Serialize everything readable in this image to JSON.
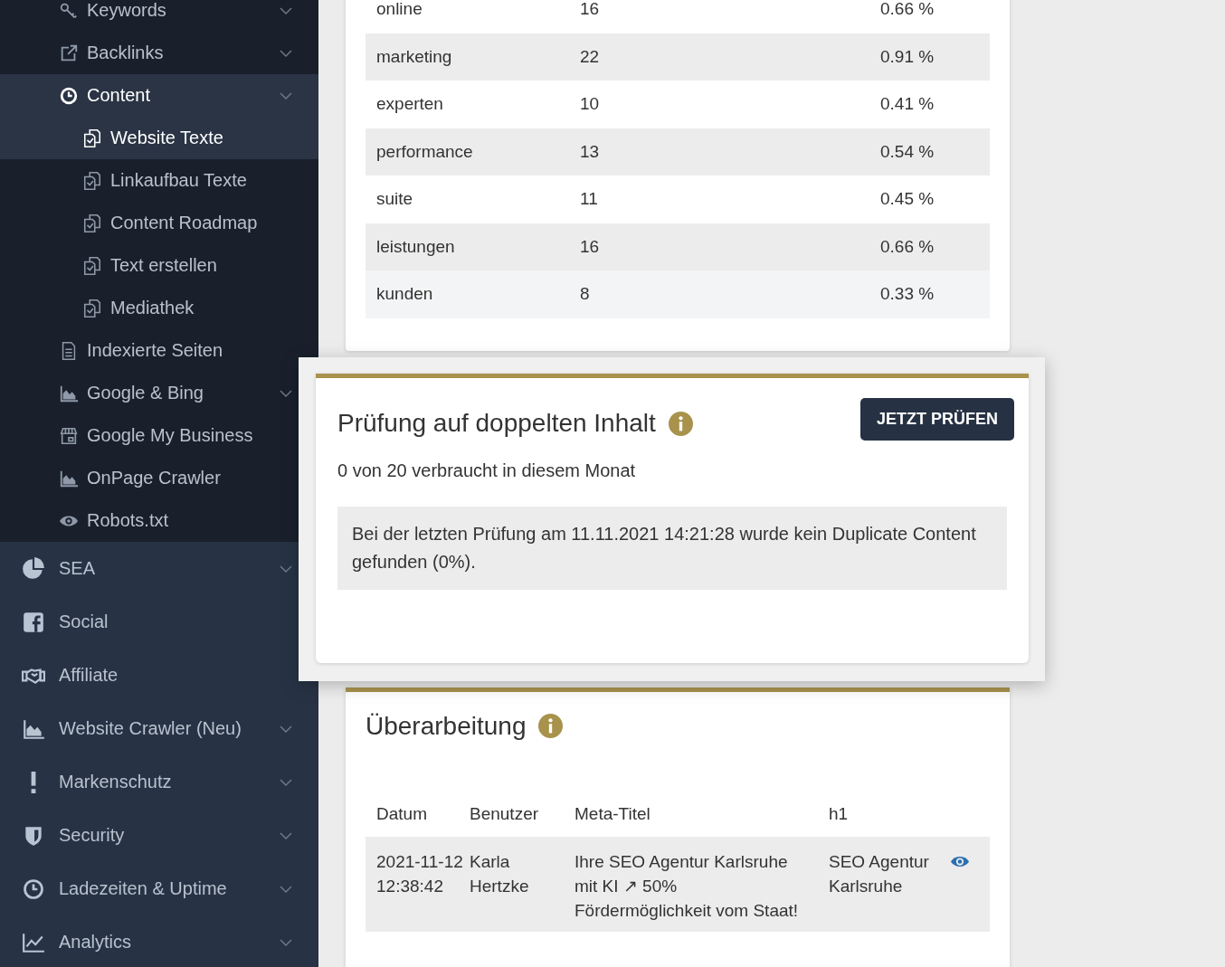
{
  "sidebar": {
    "sub_items": [
      {
        "label": "Keywords",
        "has_submenu": true,
        "expanded": false,
        "selected": false
      },
      {
        "label": "Backlinks",
        "has_submenu": true,
        "expanded": false,
        "selected": false
      },
      {
        "label": "Content",
        "has_submenu": true,
        "expanded": true,
        "selected": true,
        "children": [
          {
            "label": "Website Texte",
            "selected": true
          },
          {
            "label": "Linkaufbau Texte",
            "selected": false
          },
          {
            "label": "Content Roadmap",
            "selected": false
          },
          {
            "label": "Text erstellen",
            "selected": false
          },
          {
            "label": "Mediathek",
            "selected": false
          }
        ]
      },
      {
        "label": "Indexierte Seiten",
        "has_submenu": false,
        "selected": false
      },
      {
        "label": "Google & Bing",
        "has_submenu": true,
        "expanded": false,
        "selected": false
      },
      {
        "label": "Google My Business",
        "has_submenu": false,
        "selected": false
      },
      {
        "label": "OnPage Crawler",
        "has_submenu": false,
        "selected": false
      },
      {
        "label": "Robots.txt",
        "has_submenu": false,
        "selected": false
      }
    ],
    "items": [
      {
        "label": "SEA",
        "has_submenu": true
      },
      {
        "label": "Social",
        "has_submenu": false
      },
      {
        "label": "Affiliate",
        "has_submenu": false
      },
      {
        "label": "Website Crawler (Neu)",
        "has_submenu": true
      },
      {
        "label": "Markenschutz",
        "has_submenu": true
      },
      {
        "label": "Security",
        "has_submenu": true
      },
      {
        "label": "Ladezeiten & Uptime",
        "has_submenu": true
      },
      {
        "label": "Analytics",
        "has_submenu": true
      }
    ]
  },
  "keyword_table": {
    "rows": [
      {
        "word": "online",
        "count": "16",
        "density": "0.66 %"
      },
      {
        "word": "marketing",
        "count": "22",
        "density": "0.91 %"
      },
      {
        "word": "experten",
        "count": "10",
        "density": "0.41 %"
      },
      {
        "word": "performance",
        "count": "13",
        "density": "0.54 %"
      },
      {
        "word": "suite",
        "count": "11",
        "density": "0.45 %"
      },
      {
        "word": "leistungen",
        "count": "16",
        "density": "0.66 %"
      },
      {
        "word": "kunden",
        "count": "8",
        "density": "0.33 %"
      }
    ]
  },
  "duplicate_check": {
    "title": "Prüfung auf doppelten Inhalt",
    "button": "JETZT PRÜFEN",
    "usage": "0 von 20 verbraucht in diesem Monat",
    "result": "Bei der letzten Prüfung am 11.11.2021 14:21:28 wurde kein Duplicate Content gefunden (0%)."
  },
  "revisions": {
    "title": "Überarbeitung",
    "columns": [
      "Datum",
      "Benutzer",
      "Meta-Titel",
      "h1"
    ],
    "rows": [
      {
        "date": "2021-11-12 12:38:42",
        "user": "Karla Hertzke",
        "meta_title": "Ihre SEO Agentur Karlsruhe mit KI ↗ 50% Fördermöglichkeit vom Staat!",
        "h1": "SEO Agentur Karlsruhe"
      }
    ]
  }
}
